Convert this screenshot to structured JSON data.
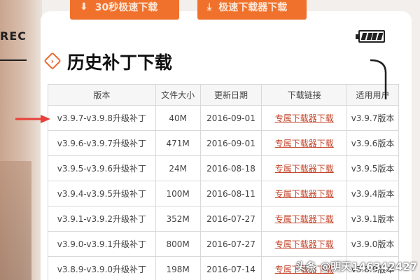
{
  "top_buttons": [
    {
      "label": "30秒极速下载"
    },
    {
      "label": "极速下载器下载"
    }
  ],
  "overlay": {
    "rec": "REC"
  },
  "heading": {
    "title": "历史补丁下载",
    "icon": "diamond-arrow-icon"
  },
  "table": {
    "headers": [
      "版本",
      "文件大小",
      "更新日期",
      "下载链接",
      "适用用户"
    ],
    "rows": [
      {
        "version": "v3.9.7-v3.9.8升级补丁",
        "size": "40M",
        "date": "2016-09-01",
        "link": "专属下载器下载",
        "user": "v3.9.7版本"
      },
      {
        "version": "v3.9.6-v3.9.7升级补丁",
        "size": "471M",
        "date": "2016-09-01",
        "link": "专属下载器下载",
        "user": "v3.9.6版本"
      },
      {
        "version": "v3.9.5-v3.9.6升级补丁",
        "size": "24M",
        "date": "2016-08-18",
        "link": "专属下载器下载",
        "user": "v3.9.5版本"
      },
      {
        "version": "v3.9.4-v3.9.5升级补丁",
        "size": "100M",
        "date": "2016-08-11",
        "link": "专属下载器下载",
        "user": "v3.9.4版本"
      },
      {
        "version": "v3.9.1-v3.9.2升级补丁",
        "size": "352M",
        "date": "2016-07-27",
        "link": "专属下载器下载",
        "user": "v3.9.1版本"
      },
      {
        "version": "v3.9.0-v3.9.1升级补丁",
        "size": "800M",
        "date": "2016-07-27",
        "link": "专属下载器下载",
        "user": "v3.9.0版本"
      },
      {
        "version": "v3.8.9-v3.9.0升级补丁",
        "size": "198M",
        "date": "2016-07-14",
        "link": "专属下载器下载",
        "user": "v3.8.9版本"
      }
    ]
  },
  "watermark": "头条 @明天146342427",
  "colors": {
    "accent": "#f0712b",
    "link": "#c4452b",
    "arrow": "#e8403a"
  }
}
